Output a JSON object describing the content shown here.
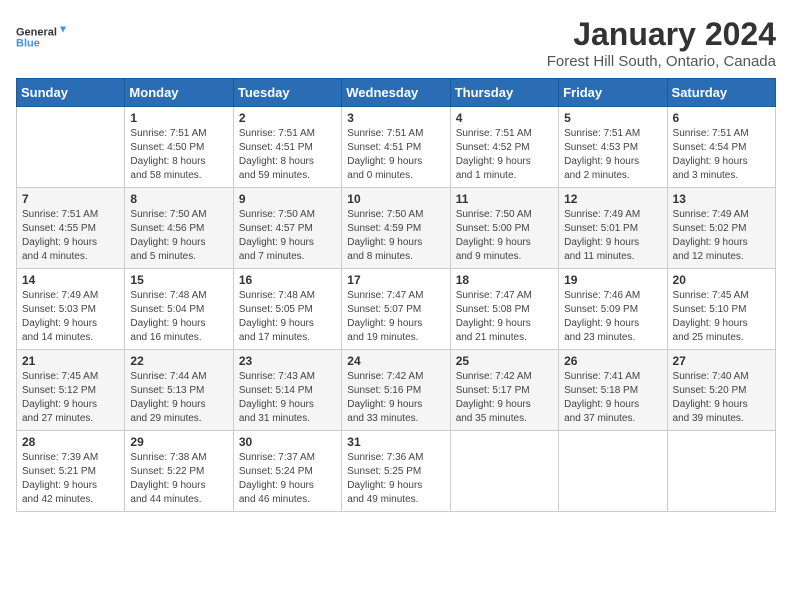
{
  "logo": {
    "line1": "General",
    "line2": "Blue"
  },
  "title": "January 2024",
  "subtitle": "Forest Hill South, Ontario, Canada",
  "days_of_week": [
    "Sunday",
    "Monday",
    "Tuesday",
    "Wednesday",
    "Thursday",
    "Friday",
    "Saturday"
  ],
  "weeks": [
    [
      {
        "num": "",
        "detail": ""
      },
      {
        "num": "1",
        "detail": "Sunrise: 7:51 AM\nSunset: 4:50 PM\nDaylight: 8 hours\nand 58 minutes."
      },
      {
        "num": "2",
        "detail": "Sunrise: 7:51 AM\nSunset: 4:51 PM\nDaylight: 8 hours\nand 59 minutes."
      },
      {
        "num": "3",
        "detail": "Sunrise: 7:51 AM\nSunset: 4:51 PM\nDaylight: 9 hours\nand 0 minutes."
      },
      {
        "num": "4",
        "detail": "Sunrise: 7:51 AM\nSunset: 4:52 PM\nDaylight: 9 hours\nand 1 minute."
      },
      {
        "num": "5",
        "detail": "Sunrise: 7:51 AM\nSunset: 4:53 PM\nDaylight: 9 hours\nand 2 minutes."
      },
      {
        "num": "6",
        "detail": "Sunrise: 7:51 AM\nSunset: 4:54 PM\nDaylight: 9 hours\nand 3 minutes."
      }
    ],
    [
      {
        "num": "7",
        "detail": "Sunrise: 7:51 AM\nSunset: 4:55 PM\nDaylight: 9 hours\nand 4 minutes."
      },
      {
        "num": "8",
        "detail": "Sunrise: 7:50 AM\nSunset: 4:56 PM\nDaylight: 9 hours\nand 5 minutes."
      },
      {
        "num": "9",
        "detail": "Sunrise: 7:50 AM\nSunset: 4:57 PM\nDaylight: 9 hours\nand 7 minutes."
      },
      {
        "num": "10",
        "detail": "Sunrise: 7:50 AM\nSunset: 4:59 PM\nDaylight: 9 hours\nand 8 minutes."
      },
      {
        "num": "11",
        "detail": "Sunrise: 7:50 AM\nSunset: 5:00 PM\nDaylight: 9 hours\nand 9 minutes."
      },
      {
        "num": "12",
        "detail": "Sunrise: 7:49 AM\nSunset: 5:01 PM\nDaylight: 9 hours\nand 11 minutes."
      },
      {
        "num": "13",
        "detail": "Sunrise: 7:49 AM\nSunset: 5:02 PM\nDaylight: 9 hours\nand 12 minutes."
      }
    ],
    [
      {
        "num": "14",
        "detail": "Sunrise: 7:49 AM\nSunset: 5:03 PM\nDaylight: 9 hours\nand 14 minutes."
      },
      {
        "num": "15",
        "detail": "Sunrise: 7:48 AM\nSunset: 5:04 PM\nDaylight: 9 hours\nand 16 minutes."
      },
      {
        "num": "16",
        "detail": "Sunrise: 7:48 AM\nSunset: 5:05 PM\nDaylight: 9 hours\nand 17 minutes."
      },
      {
        "num": "17",
        "detail": "Sunrise: 7:47 AM\nSunset: 5:07 PM\nDaylight: 9 hours\nand 19 minutes."
      },
      {
        "num": "18",
        "detail": "Sunrise: 7:47 AM\nSunset: 5:08 PM\nDaylight: 9 hours\nand 21 minutes."
      },
      {
        "num": "19",
        "detail": "Sunrise: 7:46 AM\nSunset: 5:09 PM\nDaylight: 9 hours\nand 23 minutes."
      },
      {
        "num": "20",
        "detail": "Sunrise: 7:45 AM\nSunset: 5:10 PM\nDaylight: 9 hours\nand 25 minutes."
      }
    ],
    [
      {
        "num": "21",
        "detail": "Sunrise: 7:45 AM\nSunset: 5:12 PM\nDaylight: 9 hours\nand 27 minutes."
      },
      {
        "num": "22",
        "detail": "Sunrise: 7:44 AM\nSunset: 5:13 PM\nDaylight: 9 hours\nand 29 minutes."
      },
      {
        "num": "23",
        "detail": "Sunrise: 7:43 AM\nSunset: 5:14 PM\nDaylight: 9 hours\nand 31 minutes."
      },
      {
        "num": "24",
        "detail": "Sunrise: 7:42 AM\nSunset: 5:16 PM\nDaylight: 9 hours\nand 33 minutes."
      },
      {
        "num": "25",
        "detail": "Sunrise: 7:42 AM\nSunset: 5:17 PM\nDaylight: 9 hours\nand 35 minutes."
      },
      {
        "num": "26",
        "detail": "Sunrise: 7:41 AM\nSunset: 5:18 PM\nDaylight: 9 hours\nand 37 minutes."
      },
      {
        "num": "27",
        "detail": "Sunrise: 7:40 AM\nSunset: 5:20 PM\nDaylight: 9 hours\nand 39 minutes."
      }
    ],
    [
      {
        "num": "28",
        "detail": "Sunrise: 7:39 AM\nSunset: 5:21 PM\nDaylight: 9 hours\nand 42 minutes."
      },
      {
        "num": "29",
        "detail": "Sunrise: 7:38 AM\nSunset: 5:22 PM\nDaylight: 9 hours\nand 44 minutes."
      },
      {
        "num": "30",
        "detail": "Sunrise: 7:37 AM\nSunset: 5:24 PM\nDaylight: 9 hours\nand 46 minutes."
      },
      {
        "num": "31",
        "detail": "Sunrise: 7:36 AM\nSunset: 5:25 PM\nDaylight: 9 hours\nand 49 minutes."
      },
      {
        "num": "",
        "detail": ""
      },
      {
        "num": "",
        "detail": ""
      },
      {
        "num": "",
        "detail": ""
      }
    ]
  ]
}
